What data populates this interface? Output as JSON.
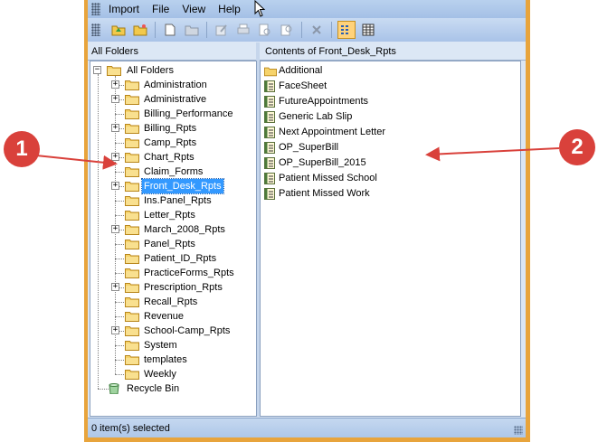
{
  "menu": [
    "Import",
    "File",
    "View",
    "Help"
  ],
  "left_header": "All Folders",
  "right_header": "Contents of Front_Desk_Rpts",
  "tree": {
    "root": "All Folders",
    "folders": [
      {
        "label": "Administration",
        "expandable": true
      },
      {
        "label": "Administrative",
        "expandable": true
      },
      {
        "label": "Billing_Performance",
        "expandable": false
      },
      {
        "label": "Billing_Rpts",
        "expandable": true
      },
      {
        "label": "Camp_Rpts",
        "expandable": false
      },
      {
        "label": "Chart_Rpts",
        "expandable": true
      },
      {
        "label": "Claim_Forms",
        "expandable": false
      },
      {
        "label": "Front_Desk_Rpts",
        "expandable": true,
        "selected": true
      },
      {
        "label": "Ins.Panel_Rpts",
        "expandable": false
      },
      {
        "label": "Letter_Rpts",
        "expandable": false
      },
      {
        "label": "March_2008_Rpts",
        "expandable": true
      },
      {
        "label": "Panel_Rpts",
        "expandable": false
      },
      {
        "label": "Patient_ID_Rpts",
        "expandable": false
      },
      {
        "label": "PracticeForms_Rpts",
        "expandable": false
      },
      {
        "label": "Prescription_Rpts",
        "expandable": true
      },
      {
        "label": "Recall_Rpts",
        "expandable": false
      },
      {
        "label": "Revenue",
        "expandable": false
      },
      {
        "label": "School-Camp_Rpts",
        "expandable": true
      },
      {
        "label": "System",
        "expandable": false
      },
      {
        "label": "templates",
        "expandable": false
      },
      {
        "label": "Weekly",
        "expandable": false
      }
    ],
    "recycle": "Recycle Bin"
  },
  "contents": [
    {
      "label": "Additional",
      "icon": "folder-icon"
    },
    {
      "label": "FaceSheet",
      "icon": "report-icon"
    },
    {
      "label": "FutureAppointments",
      "icon": "report-icon"
    },
    {
      "label": "Generic Lab Slip",
      "icon": "report-icon"
    },
    {
      "label": "Next Appointment Letter",
      "icon": "report-icon"
    },
    {
      "label": "OP_SuperBill",
      "icon": "report-icon"
    },
    {
      "label": "OP_SuperBill_2015",
      "icon": "report-icon"
    },
    {
      "label": "Patient Missed School",
      "icon": "report-icon"
    },
    {
      "label": "Patient Missed Work",
      "icon": "report-icon"
    }
  ],
  "status": "0 item(s) selected",
  "callouts": [
    "1",
    "2"
  ],
  "colors": {
    "accent_frame": "#e8a43c",
    "selection": "#3399ff",
    "callout": "#d9413b"
  }
}
